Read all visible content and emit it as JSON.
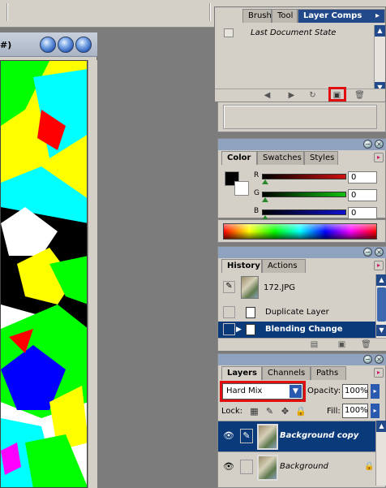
{
  "doc_window": {
    "title": "#)"
  },
  "comps_panel": {
    "tabs": [
      "Brush",
      "Tool",
      "Layer Comps"
    ],
    "items": [
      "Last Document State"
    ]
  },
  "color_panel": {
    "tabs": [
      "Color",
      "Swatches",
      "Styles"
    ],
    "channels": [
      {
        "label": "R",
        "value": "0",
        "color": "#d01010"
      },
      {
        "label": "G",
        "value": "0",
        "color": "#10c010"
      },
      {
        "label": "B",
        "value": "0",
        "color": "#1010d0"
      }
    ],
    "foreground": "#000000",
    "background": "#ffffff"
  },
  "history_panel": {
    "tabs": [
      "History",
      "Actions"
    ],
    "snapshot": "172.JPG",
    "states": [
      "Duplicate Layer",
      "Blending Change"
    ]
  },
  "layers_panel": {
    "tabs": [
      "Layers",
      "Channels",
      "Paths"
    ],
    "blend_mode": "Hard Mix",
    "opacity_label": "Opacity:",
    "opacity": "100%",
    "lock_label": "Lock:",
    "fill_label": "Fill:",
    "fill": "100%",
    "layers": [
      "Background copy",
      "Background"
    ]
  },
  "colors": {
    "panel_bg": "#d4d0c8",
    "selection": "#0a3a7a",
    "highlight": "#e01010"
  }
}
